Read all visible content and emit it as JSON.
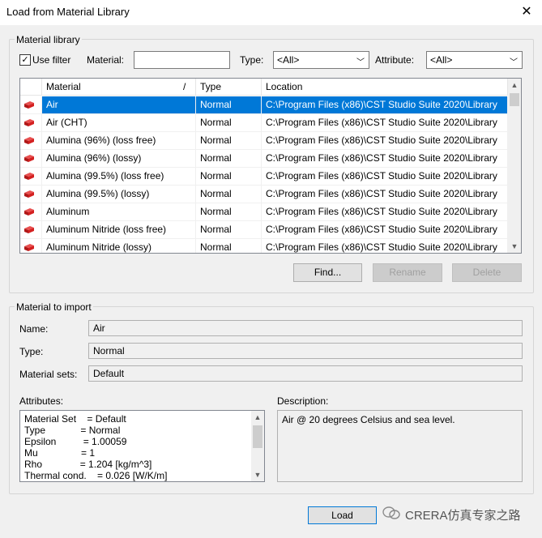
{
  "window": {
    "title": "Load from Material Library",
    "close_glyph": "✕"
  },
  "library": {
    "group_label": "Material library",
    "use_filter_label": "Use filter",
    "use_filter_checked": true,
    "material_label": "Material:",
    "material_value": "",
    "type_label": "Type:",
    "type_value": "<All>",
    "attribute_label": "Attribute:",
    "attribute_value": "<All>",
    "columns": [
      "Material",
      "Type",
      "Location"
    ],
    "sort_indicator": "/",
    "rows": [
      {
        "material": "Air",
        "type": "Normal",
        "location": "C:\\Program Files (x86)\\CST Studio Suite 2020\\Library",
        "selected": true
      },
      {
        "material": "Air (CHT)",
        "type": "Normal",
        "location": "C:\\Program Files (x86)\\CST Studio Suite 2020\\Library"
      },
      {
        "material": "Alumina (96%) (loss free)",
        "type": "Normal",
        "location": "C:\\Program Files (x86)\\CST Studio Suite 2020\\Library"
      },
      {
        "material": "Alumina (96%) (lossy)",
        "type": "Normal",
        "location": "C:\\Program Files (x86)\\CST Studio Suite 2020\\Library"
      },
      {
        "material": "Alumina (99.5%) (loss free)",
        "type": "Normal",
        "location": "C:\\Program Files (x86)\\CST Studio Suite 2020\\Library"
      },
      {
        "material": "Alumina (99.5%) (lossy)",
        "type": "Normal",
        "location": "C:\\Program Files (x86)\\CST Studio Suite 2020\\Library"
      },
      {
        "material": "Aluminum",
        "type": "Normal",
        "location": "C:\\Program Files (x86)\\CST Studio Suite 2020\\Library"
      },
      {
        "material": "Aluminum Nitride (loss free)",
        "type": "Normal",
        "location": "C:\\Program Files (x86)\\CST Studio Suite 2020\\Library"
      },
      {
        "material": "Aluminum Nitride (lossy)",
        "type": "Normal",
        "location": "C:\\Program Files (x86)\\CST Studio Suite 2020\\Library"
      }
    ],
    "find_label": "Find...",
    "rename_label": "Rename",
    "delete_label": "Delete"
  },
  "import": {
    "group_label": "Material to import",
    "name_label": "Name:",
    "name_value": "Air",
    "type_label": "Type:",
    "type_value": "Normal",
    "sets_label": "Material sets:",
    "sets_value": "Default",
    "attributes_label": "Attributes:",
    "attributes": [
      "Material Set    = Default",
      "Type             = Normal",
      "Epsilon          = 1.00059",
      "Mu                = 1",
      "Rho              = 1.204 [kg/m^3]",
      "Thermal cond.    = 0.026 [W/K/m]"
    ],
    "description_label": "Description:",
    "description_value": "Air @ 20 degrees Celsius and sea level."
  },
  "footer": {
    "load_label": "Load",
    "watermark": "CRERA仿真专家之路"
  },
  "colors": {
    "selection": "#0078d7",
    "icon": "#d42020"
  },
  "icons": {
    "row_icon": "material-brick-icon",
    "scroll_up": "▲",
    "scroll_down": "▼",
    "combo_arrow": "﹀"
  }
}
